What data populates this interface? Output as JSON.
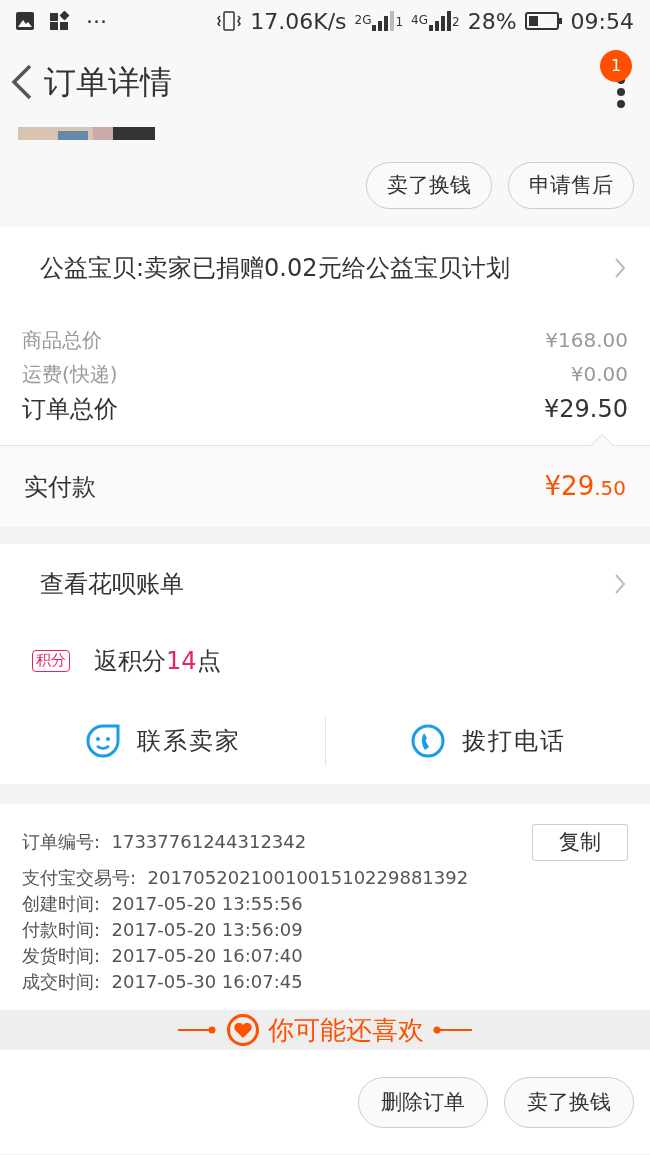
{
  "status_bar": {
    "dots": "···",
    "speed": "17.06K/s",
    "sim1": {
      "network": "2G",
      "slot": "1"
    },
    "sim2": {
      "network": "4G",
      "slot": "2"
    },
    "battery": "28%",
    "time": "09:54"
  },
  "header": {
    "title": "订单详情",
    "badge": "1"
  },
  "product": {
    "kind": "picture"
  },
  "top_actions": [
    "卖了换钱",
    "申请售后"
  ],
  "charity": {
    "text": "公益宝贝:卖家已捐赠0.02元给公益宝贝计划"
  },
  "price_rows": [
    {
      "label": "商品总价",
      "value": "¥168.00",
      "kind": "minor"
    },
    {
      "label": "运费(快递)",
      "value": "¥0.00",
      "kind": "minor"
    },
    {
      "label": "订单总价",
      "value": "¥29.50",
      "kind": "major"
    }
  ],
  "paid": {
    "label": "实付款",
    "amount_main": "¥29",
    "amount_fraction": ".50"
  },
  "huabei": {
    "text": "查看花呗账单"
  },
  "points": {
    "tag": "积分",
    "prefix": "返积分",
    "value": "14",
    "suffix": "点"
  },
  "contacts": [
    {
      "kind": "chat",
      "label": "联系卖家"
    },
    {
      "kind": "phone",
      "label": "拨打电话"
    }
  ],
  "order_info": {
    "number_label": "订单编号:",
    "number": "17337761244312342",
    "copy": "复制",
    "rows": [
      {
        "label": "支付宝交易号:",
        "value": "2017052021001001510229881392"
      },
      {
        "label": "创建时间:",
        "value": "2017-05-20 13:55:56"
      },
      {
        "label": "付款时间:",
        "value": "2017-05-20 13:56:09"
      },
      {
        "label": "发货时间:",
        "value": "2017-05-20 16:07:40"
      },
      {
        "label": "成交时间:",
        "value": "2017-05-30 16:07:45"
      }
    ]
  },
  "recommend": {
    "title": "你可能还喜欢"
  },
  "bottom_actions": [
    "删除订单",
    "卖了换钱"
  ]
}
